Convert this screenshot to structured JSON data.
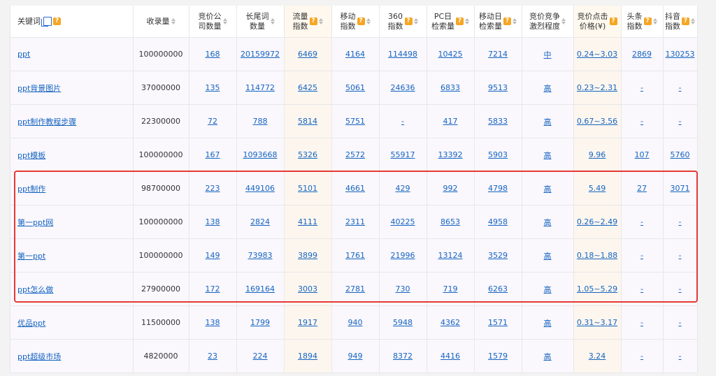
{
  "headers": [
    {
      "key": "keyword",
      "lines": [
        "关键词"
      ],
      "copy": true,
      "q": true,
      "sort": false
    },
    {
      "key": "index_count",
      "lines": [
        "收录量"
      ],
      "q": false,
      "sort": true
    },
    {
      "key": "bid_companies",
      "lines": [
        "竞价公",
        "司数量"
      ],
      "q": false,
      "sort": true
    },
    {
      "key": "long_tail",
      "lines": [
        "长尾词",
        "数量"
      ],
      "q": false,
      "sort": true
    },
    {
      "key": "traffic",
      "lines": [
        "流量",
        "指数"
      ],
      "q": true,
      "sort": true
    },
    {
      "key": "mobile",
      "lines": [
        "移动",
        "指数"
      ],
      "q": true,
      "sort": true
    },
    {
      "key": "idx360",
      "lines": [
        "360",
        "指数"
      ],
      "q": true,
      "sort": true
    },
    {
      "key": "pc_daily",
      "lines": [
        "PC日",
        "检索量"
      ],
      "q": true,
      "sort": true
    },
    {
      "key": "mobile_daily",
      "lines": [
        "移动日",
        "检索量"
      ],
      "q": true,
      "sort": true
    },
    {
      "key": "competition",
      "lines": [
        "竞价竞争",
        "激烈程度"
      ],
      "q": false,
      "sort": true
    },
    {
      "key": "cpc",
      "lines": [
        "竞价点击",
        "价格(¥)"
      ],
      "q": true,
      "sort": false
    },
    {
      "key": "toutiao",
      "lines": [
        "头条",
        "指数"
      ],
      "q": true,
      "sort": true
    },
    {
      "key": "douyin",
      "lines": [
        "抖音",
        "指数"
      ],
      "q": true,
      "sort": true
    }
  ],
  "rows": [
    [
      "ppt",
      "100000000",
      "168",
      "20159972",
      "6469",
      "4164",
      "114498",
      "10425",
      "7214",
      "中",
      "0.24~3.03",
      "2869",
      "130253"
    ],
    [
      "ppt背景图片",
      "37000000",
      "135",
      "114772",
      "6425",
      "5061",
      "24636",
      "6833",
      "9513",
      "高",
      "0.23~2.31",
      "-",
      "-"
    ],
    [
      "ppt制作教程步骤",
      "22300000",
      "72",
      "788",
      "5814",
      "5751",
      "-",
      "417",
      "5833",
      "高",
      "0.67~3.56",
      "-",
      "-"
    ],
    [
      "ppt模板",
      "100000000",
      "167",
      "1093668",
      "5326",
      "2572",
      "55917",
      "13392",
      "5903",
      "高",
      "9.96",
      "107",
      "5760"
    ],
    [
      "ppt制作",
      "98700000",
      "223",
      "449106",
      "5101",
      "4661",
      "429",
      "992",
      "4798",
      "高",
      "5.49",
      "27",
      "3071"
    ],
    [
      "第一ppt网",
      "100000000",
      "138",
      "2824",
      "4111",
      "2311",
      "40225",
      "8653",
      "4958",
      "高",
      "0.26~2.49",
      "-",
      "-"
    ],
    [
      "第一ppt",
      "100000000",
      "149",
      "73983",
      "3899",
      "1761",
      "21996",
      "13124",
      "3529",
      "高",
      "0.18~1.88",
      "-",
      "-"
    ],
    [
      "ppt怎么做",
      "27900000",
      "172",
      "169164",
      "3003",
      "2781",
      "730",
      "719",
      "6263",
      "高",
      "1.05~5.29",
      "-",
      "-"
    ],
    [
      "优品ppt",
      "11500000",
      "138",
      "1799",
      "1917",
      "940",
      "5948",
      "4362",
      "1571",
      "高",
      "0.31~3.17",
      "-",
      "-"
    ],
    [
      "ppt超级市场",
      "4820000",
      "23",
      "224",
      "1894",
      "949",
      "8372",
      "4416",
      "1579",
      "高",
      "3.24",
      "-",
      "-"
    ]
  ],
  "question_mark": "?",
  "colors": {
    "highlight": "#e53935",
    "link": "#1565c0",
    "accent": "#f5a623"
  }
}
